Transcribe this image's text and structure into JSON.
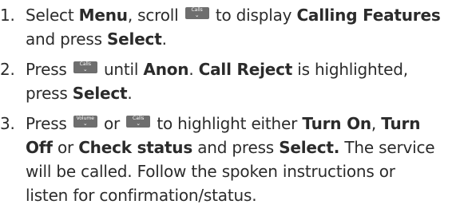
{
  "steps": [
    {
      "number": "1.",
      "parts": [
        "Select ",
        "Menu",
        ", scroll ",
        " to display ",
        "Calling Features",
        "and press ",
        "Select",
        "."
      ]
    },
    {
      "number": "2.",
      "parts": [
        "Press ",
        " until ",
        "Anon",
        ". ",
        "Call Reject",
        " is highlighted,",
        "press ",
        "Select",
        "."
      ]
    },
    {
      "number": "3.",
      "parts": [
        "Press ",
        " or ",
        " to highlight either ",
        "Turn On",
        ", ",
        "Turn",
        "Off",
        " or ",
        "Check status",
        " and press ",
        "Select",
        ".",
        " The service",
        "will be called. Follow the spoken instructions or",
        "listen for confirmation/status."
      ]
    }
  ],
  "keys": {
    "calls_label": "Calls",
    "volume_label": "Volume",
    "chevron": "⌄",
    "key_color": "#6e6e6e"
  }
}
